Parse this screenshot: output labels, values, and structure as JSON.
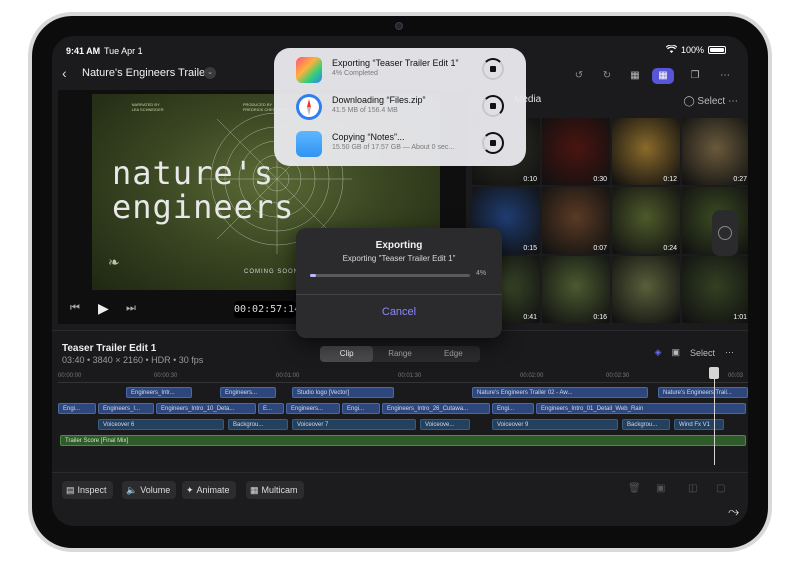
{
  "status_bar": {
    "time": "9:41 AM",
    "date": "Tue Apr 1",
    "battery": "100%"
  },
  "nav": {
    "back_icon": "chevron-left-icon",
    "project_title": "Nature's Engineers Trailer"
  },
  "viewer": {
    "poster_title": "nature's engineers",
    "poster_coming": "COMING SOON",
    "timecode": "00:02:57:14"
  },
  "browser": {
    "title": "Media",
    "select_label": "Select",
    "thumbs": [
      {
        "duration": "0:10",
        "color": "#2d2d24"
      },
      {
        "duration": "0:30",
        "color": "#4a1410"
      },
      {
        "duration": "0:12",
        "color": "#8a6a2a"
      },
      {
        "duration": "0:27",
        "color": "#6a5a3c"
      },
      {
        "duration": "0:15",
        "color": "#1f3d73"
      },
      {
        "duration": "0:07",
        "color": "#5a3a24"
      },
      {
        "duration": "0:24",
        "color": "#4e5a2a"
      },
      {
        "duration": "",
        "color": "#3a4a22"
      },
      {
        "duration": "0:41",
        "color": "#3b4a2a"
      },
      {
        "duration": "0:16",
        "color": "#4a5a30"
      },
      {
        "duration": "",
        "color": "#5a5f3a"
      },
      {
        "duration": "1:01",
        "color": "#334022"
      }
    ]
  },
  "timeline": {
    "title": "Teaser Trailer Edit 1",
    "subtitle": "03:40 • 3840 × 2160 • HDR • 30 fps",
    "segments": [
      "Clip",
      "Range",
      "Edge"
    ],
    "select_label": "Select",
    "ruler": [
      "00:00:00",
      "00:00:30",
      "00:01:00",
      "00:01:30",
      "00:02:00",
      "00:02:30",
      "00:03"
    ],
    "clips_row1": [
      "Engineers_Intr...",
      "Engineers...",
      "Studio logo [Vector]",
      "Nature's Engineers Trailer 02 - Aw...",
      "Nature's Engineers Trail..."
    ],
    "clips_row2": [
      "Engi...",
      "Engineers_I...",
      "Engineers_Intro_10_Deta...",
      "E...",
      "Engineers...",
      "Engi...",
      "Engineers_Intro_26_Cutawa...",
      "Engi...",
      "Engineers_Intro_01_Detail_Web_Rain"
    ],
    "clips_row3": [
      "Voiceover 6",
      "Backgrou...",
      "Voiceover 7",
      "Voiceove...",
      "Voiceover 9",
      "Backgrou...",
      "Wind Fx V1"
    ],
    "music": "Trailer Score [Final Mix]"
  },
  "bottom_bar": {
    "inspect": "Inspect",
    "volume": "Volume",
    "animate": "Animate",
    "multicam": "Multicam"
  },
  "downloads": [
    {
      "title": "Exporting “Teaser Trailer Edit 1”",
      "subtitle": "4% Completed",
      "icon": "final-cut-pro-icon"
    },
    {
      "title": "Downloading “Files.zip”",
      "subtitle": "41.5 MB of 156.4 MB",
      "icon": "safari-icon"
    },
    {
      "title": "Copying “Notes”...",
      "subtitle": "15.50 GB of 17.57 GB — About 0 sec...",
      "icon": "folder-icon"
    }
  ],
  "export_dialog": {
    "title": "Exporting",
    "subtitle": "Exporting \"Teaser Trailer Edit 1\"",
    "percent_label": "4%",
    "progress": 0.04,
    "cancel": "Cancel"
  }
}
